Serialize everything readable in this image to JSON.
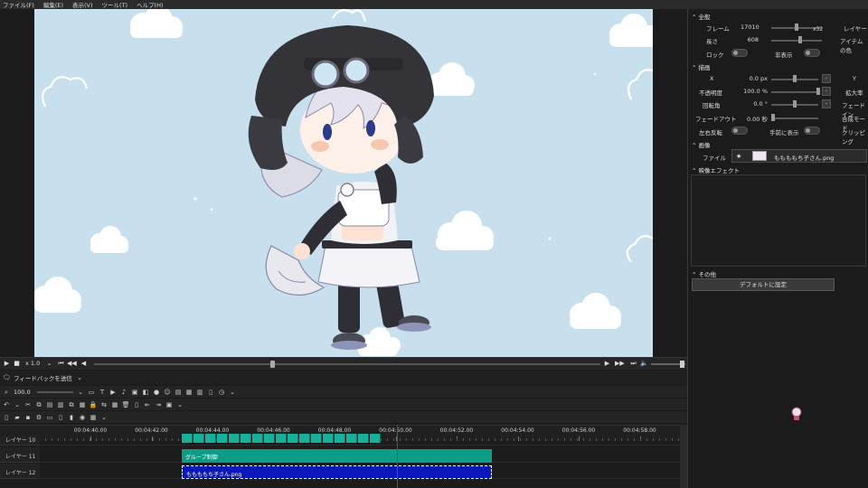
{
  "menu": [
    "ファイル(F)",
    "編集(E)",
    "表示(V)",
    "ツール(T)",
    "ヘルプ(H)"
  ],
  "playback": {
    "speed": "x 1.0"
  },
  "toolbar": {
    "feedback_label": "フィードバックを送信",
    "zoom_value": "100.0"
  },
  "timeline": {
    "ticks": [
      "00:04:40.00",
      "00:04:42.00",
      "00:04:44.00",
      "00:04:46.00",
      "00:04:48.00",
      "00:04:50.00",
      "00:04:52.00",
      "00:04:54.00",
      "00:04:56.00",
      "00:04:58.00"
    ],
    "layers": [
      {
        "label": "レイヤー 10"
      },
      {
        "label": "レイヤー 11",
        "clip": "グループ制御",
        "color": "#0d9c87"
      },
      {
        "label": "レイヤー 12",
        "clip": "ももももち子さん.png",
        "color": "#0a18b8"
      }
    ]
  },
  "props": {
    "general": {
      "title": "全般",
      "frame_label": "フレーム",
      "frame_value": "17010",
      "frame_mult": "x32",
      "layer_label": "レイヤー",
      "length_label": "長さ",
      "length_value": "608",
      "anchor_label": "アイテムの色",
      "lock_label": "ロック",
      "hide_label": "非表示"
    },
    "draw": {
      "title": "描画",
      "x_label": "X",
      "x_value": "0.0 px",
      "y_label": "Y",
      "opacity_label": "不透明度",
      "opacity_value": "100.0 %",
      "zoom_label": "拡大率",
      "rotation_label": "回転角",
      "rotation_value": "0.0 °",
      "fadein_label": "フェードイン",
      "fadeout_label": "フェードアウト",
      "fadeout_value": "0.00 秒",
      "blend_label": "合成モード",
      "flip_label": "左右反転",
      "front_label": "手前に表示",
      "clip_label": "クリッピング"
    },
    "image": {
      "title": "画像",
      "file_label": "ファイル",
      "file_value": "ももももち子さん.png"
    },
    "effects": {
      "title": "映像エフェクト"
    },
    "other": {
      "title": "その他",
      "default_button": "デフォルトに設定"
    }
  },
  "colors": {
    "canvas_bg": "#c8e0ee",
    "accent_red": "#d02020"
  }
}
